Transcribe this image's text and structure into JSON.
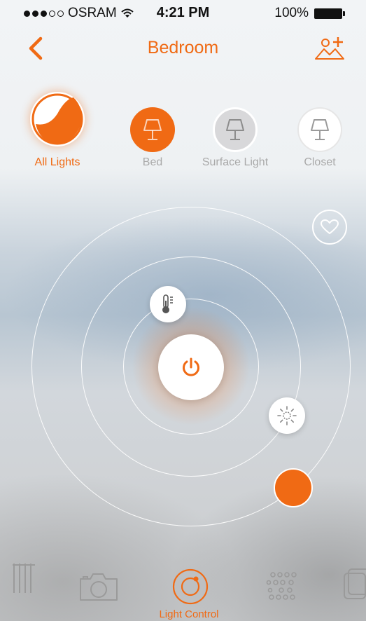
{
  "status_bar": {
    "carrier": "OSRAM",
    "time": "4:21 PM",
    "battery": "100%"
  },
  "header": {
    "title": "Bedroom"
  },
  "lights": [
    {
      "label": "All Lights",
      "active": true
    },
    {
      "label": "Bed",
      "active": false
    },
    {
      "label": "Surface Light",
      "active": false
    },
    {
      "label": "Closet",
      "active": false
    }
  ],
  "controls": {
    "power": "power-icon",
    "temperature": "thermometer-icon",
    "brightness": "brightness-icon",
    "favorite": "heart-icon"
  },
  "tabs": {
    "active_label": "Light Control"
  },
  "colors": {
    "accent": "#f06a14",
    "ring": "#ffffff",
    "inactive_text": "#a9a9a9"
  }
}
